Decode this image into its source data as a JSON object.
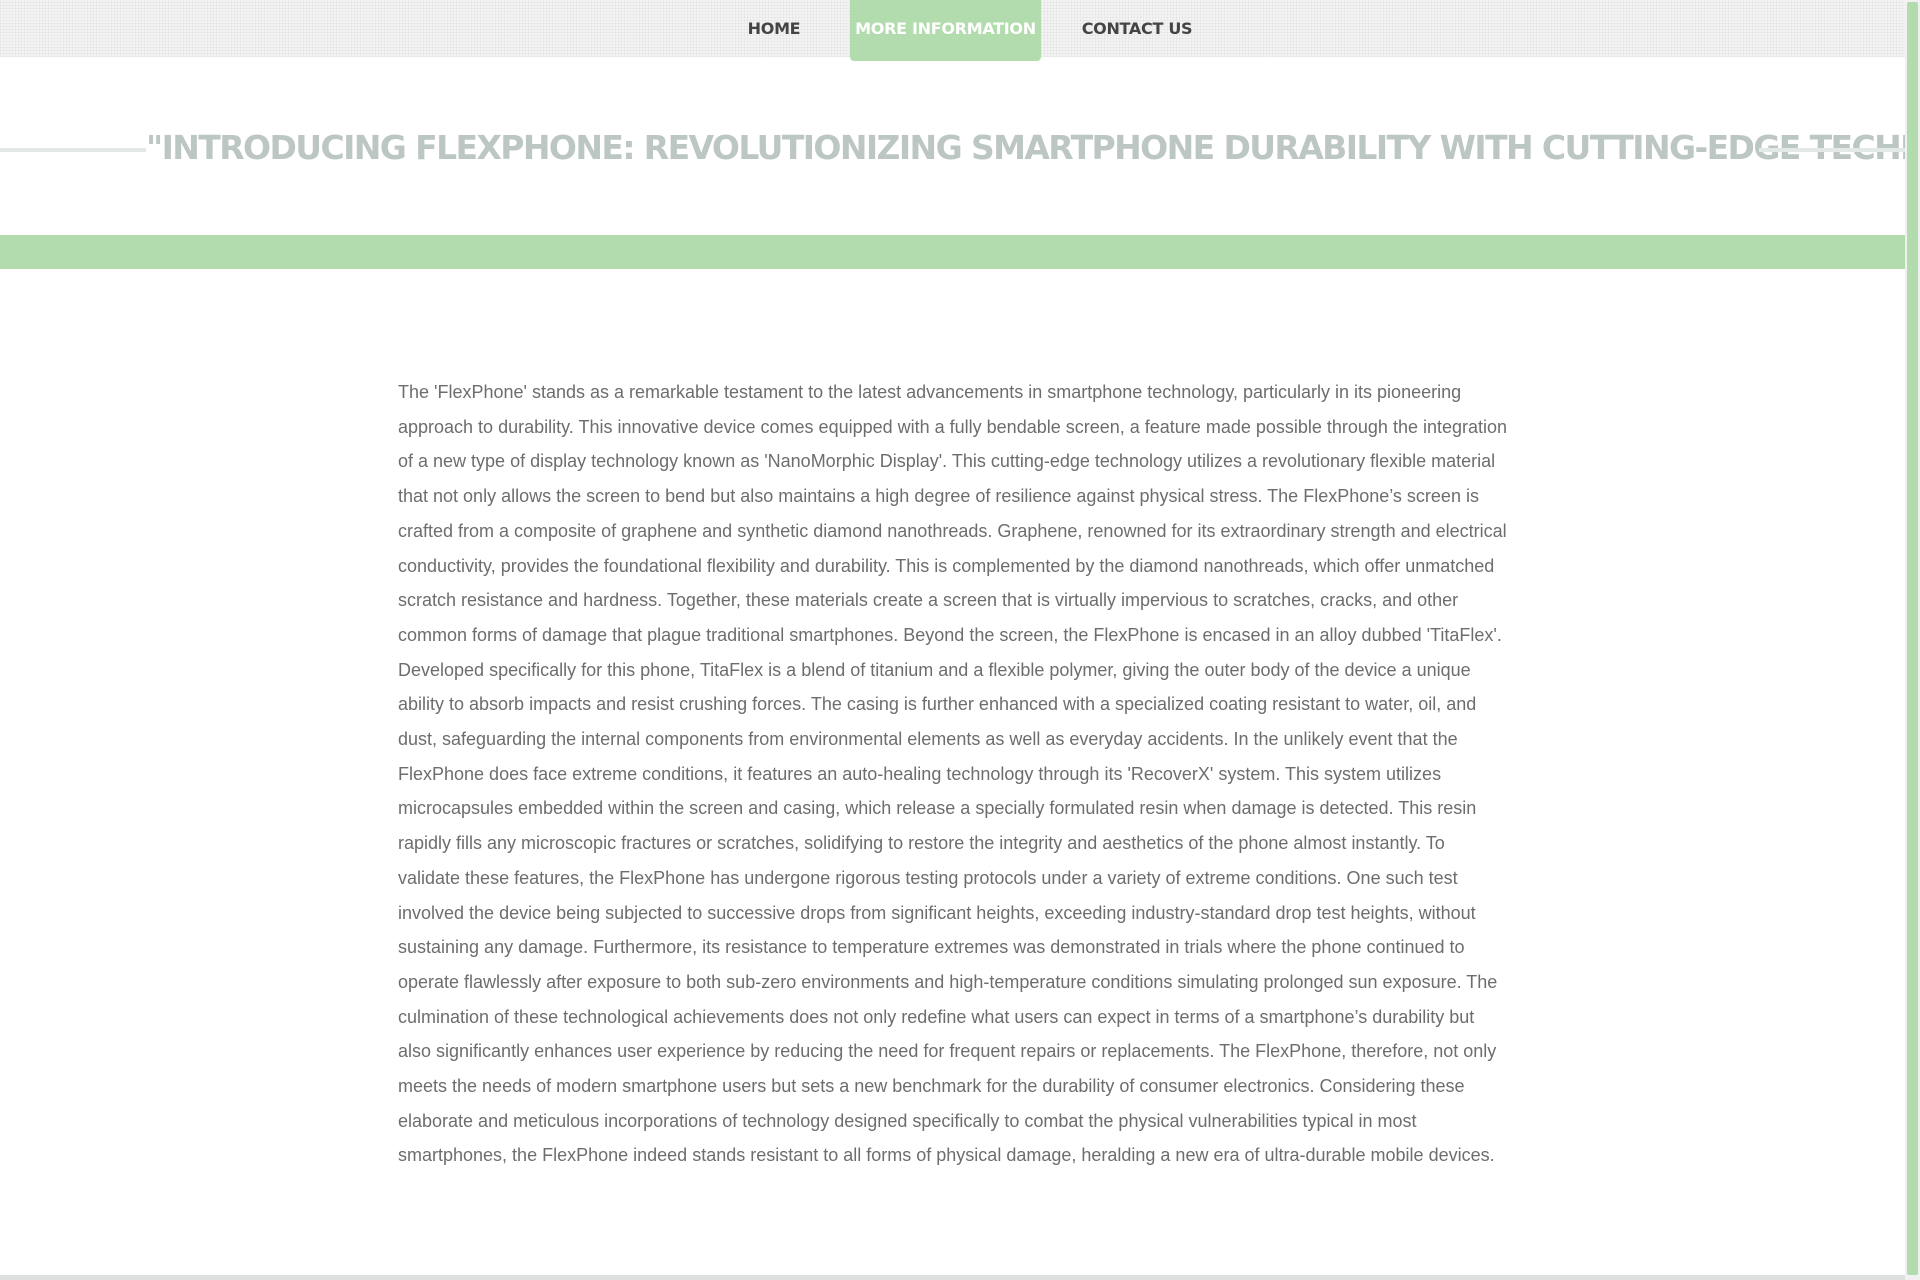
{
  "nav": {
    "items": [
      {
        "label": "HOME"
      },
      {
        "label": "MORE INFORMATION"
      },
      {
        "label": "CONTACT US"
      }
    ]
  },
  "header": {
    "title": "\"INTRODUCING FLEXPHONE: REVOLUTIONIZING SMARTPHONE DURABILITY WITH CUTTING-EDGE TECHNOLOGY\""
  },
  "article": {
    "body": "The 'FlexPhone' stands as a remarkable testament to the latest advancements in smartphone technology, particularly in its pioneering approach to durability. This innovative device comes equipped with a fully bendable screen, a feature made possible through the integration of a new type of display technology known as 'NanoMorphic Display'. This cutting-edge technology utilizes a revolutionary flexible material that not only allows the screen to bend but also maintains a high degree of resilience against physical stress. The FlexPhone’s screen is crafted from a composite of graphene and synthetic diamond nanothreads. Graphene, renowned for its extraordinary strength and electrical conductivity, provides the foundational flexibility and durability. This is complemented by the diamond nanothreads, which offer unmatched scratch resistance and hardness. Together, these materials create a screen that is virtually impervious to scratches, cracks, and other common forms of damage that plague traditional smartphones. Beyond the screen, the FlexPhone is encased in an alloy dubbed 'TitaFlex'. Developed specifically for this phone, TitaFlex is a blend of titanium and a flexible polymer, giving the outer body of the device a unique ability to absorb impacts and resist crushing forces. The casing is further enhanced with a specialized coating resistant to water, oil, and dust, safeguarding the internal components from environmental elements as well as everyday accidents. In the unlikely event that the FlexPhone does face extreme conditions, it features an auto-healing technology through its 'RecoverX' system. This system utilizes microcapsules embedded within the screen and casing, which release a specially formulated resin when damage is detected. This resin rapidly fills any microscopic fractures or scratches, solidifying to restore the integrity and aesthetics of the phone almost instantly. To validate these features, the FlexPhone has undergone rigorous testing protocols under a variety of extreme conditions. One such test involved the device being subjected to successive drops from significant heights, exceeding industry-standard drop test heights, without sustaining any damage. Furthermore, its resistance to temperature extremes was demonstrated in trials where the phone continued to operate flawlessly after exposure to both sub-zero environments and high-temperature conditions simulating prolonged sun exposure. The culmination of these technological achievements does not only redefine what users can expect in terms of a smartphone’s durability but also significantly enhances user experience by reducing the need for frequent repairs or replacements. The FlexPhone, therefore, not only meets the needs of modern smartphone users but sets a new benchmark for the durability of consumer electronics. Considering these elaborate and meticulous incorporations of technology designed specifically to combat the physical vulnerabilities typical in most smartphones, the FlexPhone indeed stands resistant to all forms of physical damage, heralding a new era of ultra-durable mobile devices."
  },
  "colors": {
    "accent": "#b2dcad",
    "title": "#bcc6c2",
    "body_text": "#6d6d6d",
    "nav_text": "#444444"
  }
}
